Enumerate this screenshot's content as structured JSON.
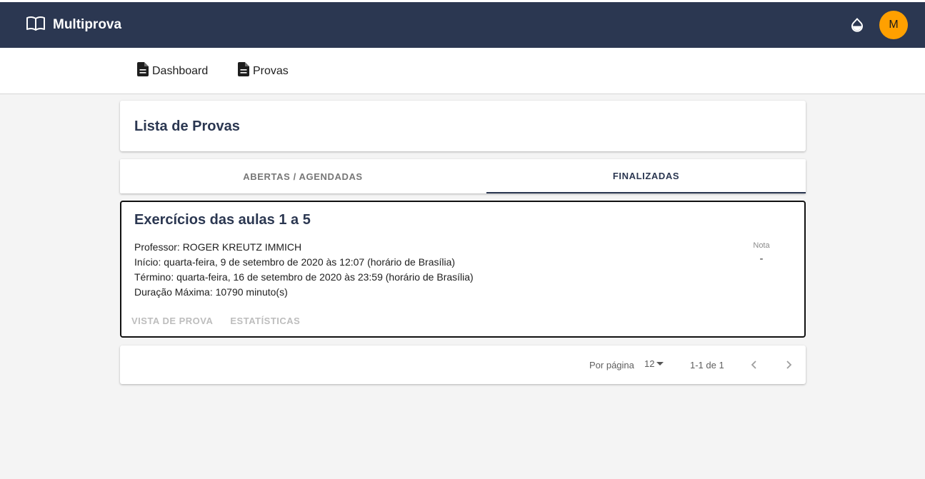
{
  "app": {
    "title": "Multiprova",
    "avatar_initial": "M",
    "brand_color": "#2b3751",
    "avatar_color": "#ffa000"
  },
  "icons": {
    "brand": "book-open-icon",
    "theme": "water-drop-icon",
    "nav_doc": "document-icon",
    "prev": "chevron-left-icon",
    "next": "chevron-right-icon"
  },
  "nav": {
    "items": [
      {
        "label": "Dashboard"
      },
      {
        "label": "Provas"
      }
    ]
  },
  "page": {
    "title": "Lista de Provas"
  },
  "tabs": [
    {
      "label": "ABERTAS / AGENDADAS",
      "active": false
    },
    {
      "label": "FINALIZADAS",
      "active": true
    }
  ],
  "exam": {
    "title": "Exercícios das aulas 1 a 5",
    "professor": "Professor: ROGER KREUTZ IMMICH",
    "inicio": "Início: quarta-feira, 9 de setembro de 2020 às 12:07 (horário de Brasília)",
    "termino": "Término: quarta-feira, 16 de setembro de 2020 às 23:59 (horário de Brasília)",
    "duracao": "Duração Máxima: 10790 minuto(s)",
    "grade_label": "Nota",
    "grade_value": "-",
    "actions": [
      {
        "label": "VISTA DE PROVA"
      },
      {
        "label": "ESTATÍSTICAS"
      }
    ]
  },
  "pagination": {
    "per_page_label": "Por página",
    "per_page_value": "12",
    "range": "1-1 de 1"
  }
}
